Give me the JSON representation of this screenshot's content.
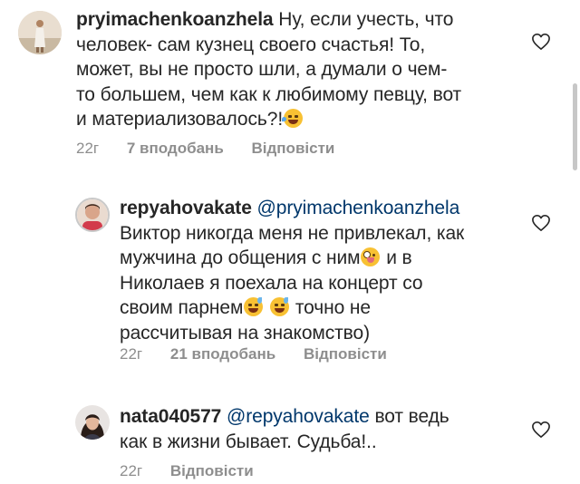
{
  "comments": [
    {
      "username": "pryimachenkoanzhela",
      "mention": "",
      "lines": [
        "Ну, если учесть, что",
        "человек- сам кузнец своего счастья! То,",
        "может, вы не просто шли, а думали о чем-",
        "то большем, чем как к любимому певцу, вот",
        "и материализовалось?!"
      ],
      "age": "22г",
      "likes": "7 вподобань",
      "reply": "Відповісти",
      "emojis": [
        "face-with-tears-of-joy"
      ]
    },
    {
      "username": "repyahovakate",
      "mention": "@pryimachenkoanzhela",
      "lines": [
        "Виктор никогда меня не привлекал, как",
        "мужчина до общения с ним",
        "и в",
        "Николаев я поехала на концерт со",
        "своим парнем",
        "точно не",
        "рассчитывая на знакомство)"
      ],
      "age": "22г",
      "likes": "21 вподобань",
      "reply": "Відповісти",
      "emojis": [
        "zany-face",
        "grinning-face-with-sweat",
        "grinning-face-with-sweat"
      ]
    },
    {
      "username": "nata040577",
      "mention": "@repyahovakate",
      "lines": [
        "вот ведь",
        "как в жизни бывает. Судьба!.."
      ],
      "age": "22г",
      "likes": "",
      "reply": "Відповісти",
      "emojis": []
    }
  ]
}
